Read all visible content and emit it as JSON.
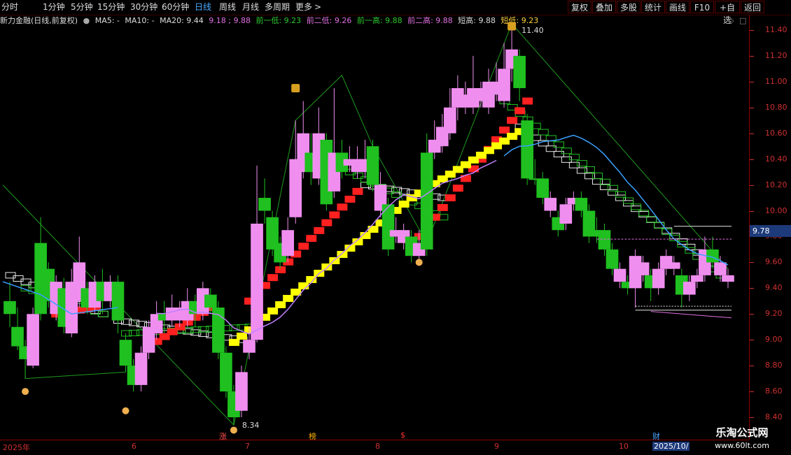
{
  "toolbar": {
    "periods": [
      "分时",
      "1分钟",
      "5分钟",
      "15分钟",
      "30分钟",
      "60分钟",
      "日线",
      "周线",
      "月线",
      "多周期",
      "更多"
    ],
    "active_period": "日线",
    "right_buttons": [
      "复权",
      "叠加",
      "多股",
      "统计",
      "画线",
      "F10",
      "+自选",
      "返回"
    ]
  },
  "info": {
    "stock": "新力金融(日线,前复权)",
    "ma5": "MA5: -",
    "ma10": "MA10: -",
    "ma20": "MA20: 9.44",
    "levels": "9.18 ; 9.88",
    "prev_low1": "前一低: 9.23",
    "prev_low2": "前二低: 9.26",
    "prev_high1": "前一高: 9.88",
    "prev_high2": "前二高: 9.88",
    "short_high": "短高: 9.88",
    "short_low": "短低: 9.23"
  },
  "y_axis": {
    "ticks": [
      "11.40",
      "11.20",
      "11.00",
      "10.80",
      "10.60",
      "10.40",
      "10.20",
      "10.00",
      "9.80",
      "9.60",
      "9.40",
      "9.20",
      "9.00",
      "8.80",
      "8.60",
      "8.40"
    ],
    "current_price": "9.78"
  },
  "x_axis": {
    "labels": [
      "2025年",
      "6",
      "7",
      "8",
      "9",
      "10",
      "2025/10/"
    ],
    "markers": [
      "涨",
      "榜",
      "$",
      "财"
    ]
  },
  "annotations": {
    "high_label": "11.40",
    "low_label": "8.34"
  },
  "watermark": {
    "line1": "乐淘公式网",
    "line2": "www.60lt.com"
  },
  "colors": {
    "background": "#000000",
    "up_candle": "#f08ef0",
    "down_candle": "#1fc01f",
    "red_steps": "#ff2020",
    "yellow_steps": "#ffff00",
    "white_steps": "#e8e8e8",
    "green_steps": "#22c022",
    "ma_purple": "#c080ff",
    "ma_blue": "#3aa0ff",
    "axis": "#d03030",
    "current_price_bg": "#1d3a7a"
  },
  "chart_data": {
    "type": "candlestick",
    "ylim": [
      8.3,
      11.5
    ],
    "candles": [
      {
        "o": 9.3,
        "c": 9.2,
        "h": 9.45,
        "l": 9.1,
        "up": false
      },
      {
        "o": 9.1,
        "c": 8.95,
        "h": 9.25,
        "l": 8.92,
        "up": false
      },
      {
        "o": 8.95,
        "c": 8.85,
        "h": 9.0,
        "l": 8.7,
        "up": false
      },
      {
        "o": 8.8,
        "c": 9.2,
        "h": 9.25,
        "l": 8.78,
        "up": true
      },
      {
        "o": 9.2,
        "c": 9.75,
        "h": 9.95,
        "l": 9.15,
        "up": false
      },
      {
        "o": 9.55,
        "c": 9.3,
        "h": 9.6,
        "l": 9.25,
        "up": false
      },
      {
        "o": 9.2,
        "c": 9.45,
        "h": 9.5,
        "l": 9.15,
        "up": true
      },
      {
        "o": 9.4,
        "c": 9.1,
        "h": 9.48,
        "l": 9.05,
        "up": false
      },
      {
        "o": 9.05,
        "c": 9.45,
        "h": 9.55,
        "l": 9.02,
        "up": true
      },
      {
        "o": 9.3,
        "c": 9.6,
        "h": 9.8,
        "l": 9.25,
        "up": true
      },
      {
        "o": 9.4,
        "c": 9.25,
        "h": 9.45,
        "l": 9.2,
        "up": false
      },
      {
        "o": 9.25,
        "c": 9.45,
        "h": 9.5,
        "l": 9.2,
        "up": true
      },
      {
        "o": 9.45,
        "c": 9.3,
        "h": 9.55,
        "l": 9.2,
        "up": false
      },
      {
        "o": 9.3,
        "c": 9.45,
        "h": 9.5,
        "l": 9.25,
        "up": true
      },
      {
        "o": 9.45,
        "c": 9.15,
        "h": 9.5,
        "l": 9.05,
        "up": false
      },
      {
        "o": 9.0,
        "c": 8.8,
        "h": 9.05,
        "l": 8.75,
        "up": false
      },
      {
        "o": 8.8,
        "c": 8.65,
        "h": 8.85,
        "l": 8.6,
        "up": false
      },
      {
        "o": 8.65,
        "c": 8.9,
        "h": 8.95,
        "l": 8.6,
        "up": true
      },
      {
        "o": 8.9,
        "c": 9.1,
        "h": 9.15,
        "l": 8.85,
        "up": true
      },
      {
        "o": 9.05,
        "c": 9.2,
        "h": 9.3,
        "l": 9.0,
        "up": true
      },
      {
        "o": 9.2,
        "c": 9.15,
        "h": 9.3,
        "l": 9.05,
        "up": false
      },
      {
        "o": 9.15,
        "c": 9.25,
        "h": 9.35,
        "l": 9.1,
        "up": true
      },
      {
        "o": 9.25,
        "c": 9.15,
        "h": 9.3,
        "l": 9.1,
        "up": true
      },
      {
        "o": 9.15,
        "c": 9.3,
        "h": 9.4,
        "l": 9.1,
        "up": true
      },
      {
        "o": 9.3,
        "c": 9.2,
        "h": 9.35,
        "l": 9.1,
        "up": false
      },
      {
        "o": 9.2,
        "c": 9.4,
        "h": 9.45,
        "l": 9.15,
        "up": true
      },
      {
        "o": 9.35,
        "c": 9.25,
        "h": 9.4,
        "l": 9.2,
        "up": false
      },
      {
        "o": 9.25,
        "c": 8.9,
        "h": 9.3,
        "l": 8.85,
        "up": false
      },
      {
        "o": 8.9,
        "c": 8.6,
        "h": 8.95,
        "l": 8.55,
        "up": false
      },
      {
        "o": 8.6,
        "c": 8.4,
        "h": 8.65,
        "l": 8.34,
        "up": false
      },
      {
        "o": 8.45,
        "c": 8.75,
        "h": 8.8,
        "l": 8.4,
        "up": true
      },
      {
        "o": 8.9,
        "c": 9.0,
        "h": 9.1,
        "l": 8.85,
        "up": true
      },
      {
        "o": 9.0,
        "c": 9.9,
        "h": 10.35,
        "l": 8.98,
        "up": true
      },
      {
        "o": 10.0,
        "c": 10.1,
        "h": 10.25,
        "l": 9.9,
        "up": false
      },
      {
        "o": 9.95,
        "c": 9.7,
        "h": 10.0,
        "l": 9.65,
        "up": false
      },
      {
        "o": 9.75,
        "c": 9.6,
        "h": 9.8,
        "l": 9.55,
        "up": false
      },
      {
        "o": 9.65,
        "c": 9.85,
        "h": 9.95,
        "l": 9.6,
        "up": true
      },
      {
        "o": 9.95,
        "c": 10.4,
        "h": 10.7,
        "l": 9.9,
        "up": true
      },
      {
        "o": 10.3,
        "c": 10.6,
        "h": 10.85,
        "l": 10.25,
        "up": true
      },
      {
        "o": 10.45,
        "c": 10.3,
        "h": 10.6,
        "l": 10.2,
        "up": false
      },
      {
        "o": 10.25,
        "c": 10.6,
        "h": 10.8,
        "l": 10.2,
        "up": true
      },
      {
        "o": 10.55,
        "c": 10.05,
        "h": 10.6,
        "l": 10.0,
        "up": false
      },
      {
        "o": 10.15,
        "c": 10.45,
        "h": 10.95,
        "l": 10.1,
        "up": true
      },
      {
        "o": 10.45,
        "c": 10.3,
        "h": 10.55,
        "l": 10.25,
        "up": false
      },
      {
        "o": 10.35,
        "c": 10.4,
        "h": 10.5,
        "l": 10.3,
        "up": true
      },
      {
        "o": 10.4,
        "c": 10.3,
        "h": 10.5,
        "l": 10.25,
        "up": true
      },
      {
        "o": 10.3,
        "c": 10.4,
        "h": 10.55,
        "l": 10.25,
        "up": true
      },
      {
        "o": 10.5,
        "c": 10.2,
        "h": 10.55,
        "l": 10.15,
        "up": false
      },
      {
        "o": 10.2,
        "c": 10.0,
        "h": 10.3,
        "l": 9.95,
        "up": true
      },
      {
        "o": 10.05,
        "c": 9.7,
        "h": 10.1,
        "l": 9.65,
        "up": false
      },
      {
        "o": 9.8,
        "c": 9.85,
        "h": 9.95,
        "l": 9.75,
        "up": true
      },
      {
        "o": 9.85,
        "c": 9.75,
        "h": 9.9,
        "l": 9.7,
        "up": true
      },
      {
        "o": 9.8,
        "c": 9.65,
        "h": 9.85,
        "l": 9.6,
        "up": false
      },
      {
        "o": 9.65,
        "c": 9.75,
        "h": 9.85,
        "l": 9.6,
        "up": true
      },
      {
        "o": 9.7,
        "c": 10.45,
        "h": 10.6,
        "l": 9.65,
        "up": false
      },
      {
        "o": 10.55,
        "c": 10.45,
        "h": 10.7,
        "l": 10.4,
        "up": true
      },
      {
        "o": 10.5,
        "c": 10.65,
        "h": 10.75,
        "l": 10.45,
        "up": true
      },
      {
        "o": 10.6,
        "c": 10.8,
        "h": 10.95,
        "l": 10.55,
        "up": true
      },
      {
        "o": 10.8,
        "c": 10.95,
        "h": 11.05,
        "l": 10.7,
        "up": true
      },
      {
        "o": 10.9,
        "c": 10.8,
        "h": 11.0,
        "l": 10.75,
        "up": true
      },
      {
        "o": 10.8,
        "c": 10.95,
        "h": 11.2,
        "l": 10.75,
        "up": true
      },
      {
        "o": 10.95,
        "c": 10.85,
        "h": 11.0,
        "l": 10.8,
        "up": true
      },
      {
        "o": 10.8,
        "c": 11.0,
        "h": 11.1,
        "l": 10.75,
        "up": true
      },
      {
        "o": 11.0,
        "c": 10.9,
        "h": 11.15,
        "l": 10.85,
        "up": true
      },
      {
        "o": 10.85,
        "c": 11.1,
        "h": 11.3,
        "l": 10.8,
        "up": true
      },
      {
        "o": 11.1,
        "c": 11.25,
        "h": 11.4,
        "l": 11.0,
        "up": true
      },
      {
        "o": 11.2,
        "c": 10.95,
        "h": 11.25,
        "l": 10.85,
        "up": false
      },
      {
        "o": 10.7,
        "c": 10.25,
        "h": 10.75,
        "l": 10.2,
        "up": false
      },
      {
        "o": 10.25,
        "c": 10.25,
        "h": 10.4,
        "l": 10.2,
        "up": false
      },
      {
        "o": 10.25,
        "c": 10.1,
        "h": 10.3,
        "l": 10.05,
        "up": false
      },
      {
        "o": 10.1,
        "c": 10.0,
        "h": 10.15,
        "l": 9.95,
        "up": true
      },
      {
        "o": 9.95,
        "c": 9.85,
        "h": 10.0,
        "l": 9.8,
        "up": false
      },
      {
        "o": 9.9,
        "c": 10.05,
        "h": 10.1,
        "l": 9.85,
        "up": true
      },
      {
        "o": 10.05,
        "c": 10.1,
        "h": 10.15,
        "l": 10.0,
        "up": true
      },
      {
        "o": 10.1,
        "c": 10.0,
        "h": 10.15,
        "l": 9.95,
        "up": false
      },
      {
        "o": 10.0,
        "c": 9.8,
        "h": 10.05,
        "l": 9.75,
        "up": false
      },
      {
        "o": 9.8,
        "c": 9.85,
        "h": 9.95,
        "l": 9.75,
        "up": false
      },
      {
        "o": 9.85,
        "c": 9.7,
        "h": 9.9,
        "l": 9.65,
        "up": false
      },
      {
        "o": 9.7,
        "c": 9.55,
        "h": 9.75,
        "l": 9.5,
        "up": false
      },
      {
        "o": 9.55,
        "c": 9.45,
        "h": 9.6,
        "l": 9.4,
        "up": true
      },
      {
        "o": 9.45,
        "c": 9.4,
        "h": 9.5,
        "l": 9.35,
        "up": false
      },
      {
        "o": 9.4,
        "c": 9.65,
        "h": 9.7,
        "l": 9.25,
        "up": true
      },
      {
        "o": 9.6,
        "c": 9.5,
        "h": 9.65,
        "l": 9.45,
        "up": true
      },
      {
        "o": 9.5,
        "c": 9.4,
        "h": 9.55,
        "l": 9.3,
        "up": false
      },
      {
        "o": 9.4,
        "c": 9.55,
        "h": 9.6,
        "l": 9.35,
        "up": true
      },
      {
        "o": 9.55,
        "c": 9.65,
        "h": 9.7,
        "l": 9.5,
        "up": true
      },
      {
        "o": 9.6,
        "c": 9.55,
        "h": 9.65,
        "l": 9.5,
        "up": true
      },
      {
        "o": 9.5,
        "c": 9.35,
        "h": 9.55,
        "l": 9.25,
        "up": false
      },
      {
        "o": 9.35,
        "c": 9.45,
        "h": 9.5,
        "l": 9.3,
        "up": true
      },
      {
        "o": 9.45,
        "c": 9.5,
        "h": 9.55,
        "l": 9.4,
        "up": true
      },
      {
        "o": 9.5,
        "c": 9.7,
        "h": 9.8,
        "l": 9.45,
        "up": true
      },
      {
        "o": 9.7,
        "c": 9.6,
        "h": 9.8,
        "l": 9.55,
        "up": false
      },
      {
        "o": 9.6,
        "c": 9.5,
        "h": 9.65,
        "l": 9.45,
        "up": true
      },
      {
        "o": 9.5,
        "c": 9.45,
        "h": 9.55,
        "l": 9.4,
        "up": true
      }
    ]
  }
}
